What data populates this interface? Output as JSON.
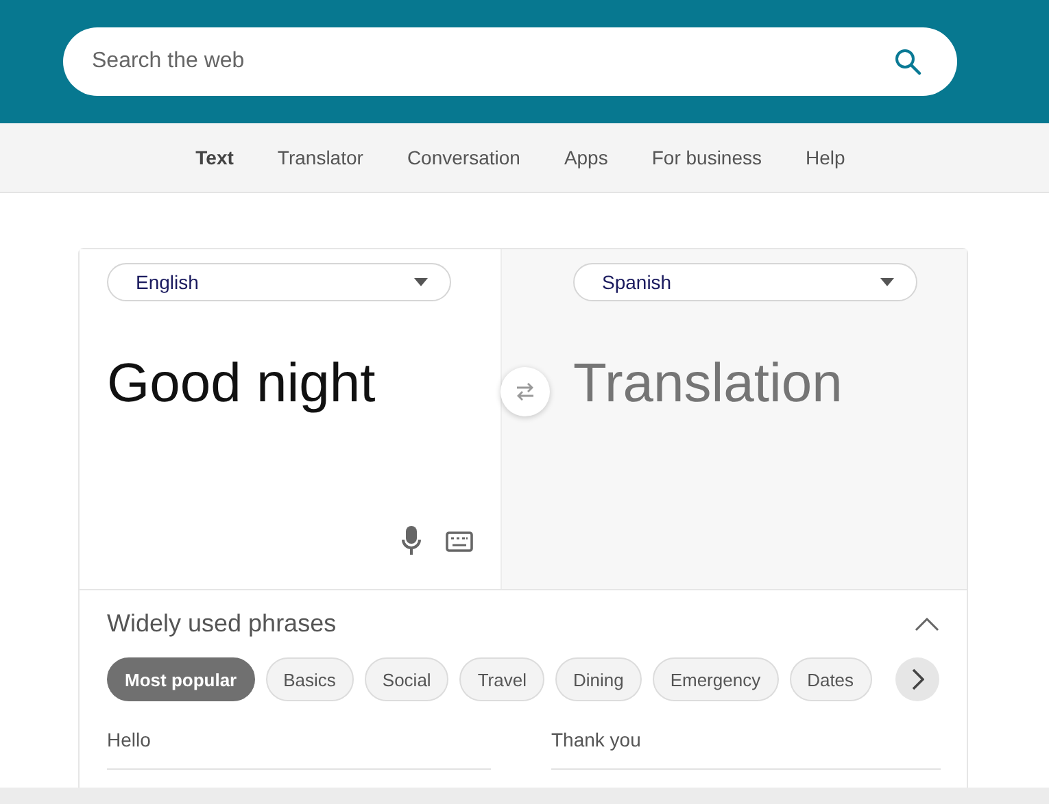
{
  "search": {
    "placeholder": "Search the web"
  },
  "nav": [
    {
      "label": "Text",
      "selected": true
    },
    {
      "label": "Translator",
      "selected": false
    },
    {
      "label": "Conversation",
      "selected": false
    },
    {
      "label": "Apps",
      "selected": false
    },
    {
      "label": "For business",
      "selected": false
    },
    {
      "label": "Help",
      "selected": false
    }
  ],
  "source": {
    "language": "English",
    "text": "Good night"
  },
  "target": {
    "language": "Spanish",
    "placeholder": "Translation"
  },
  "phrases": {
    "title": "Widely used phrases",
    "expanded": true,
    "categories": [
      {
        "label": "Most popular",
        "selected": true
      },
      {
        "label": "Basics",
        "selected": false
      },
      {
        "label": "Social",
        "selected": false
      },
      {
        "label": "Travel",
        "selected": false
      },
      {
        "label": "Dining",
        "selected": false
      },
      {
        "label": "Emergency",
        "selected": false
      },
      {
        "label": "Dates",
        "selected": false
      }
    ],
    "items": [
      "Hello",
      "Thank you"
    ]
  }
}
